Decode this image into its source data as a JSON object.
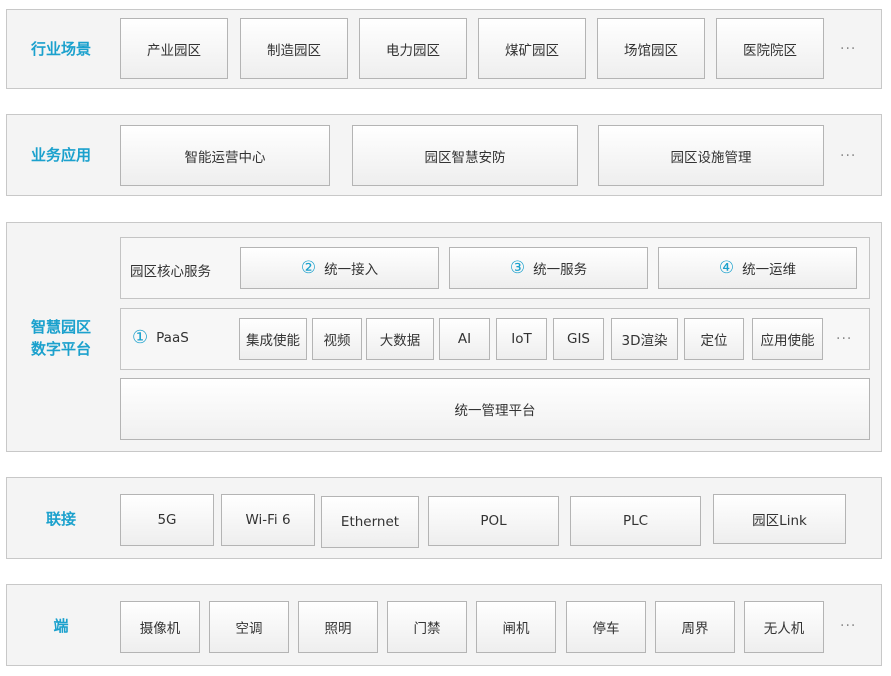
{
  "layers": {
    "scenarios": {
      "label": "行业场景",
      "items": [
        "产业园区",
        "制造园区",
        "电力园区",
        "煤矿园区",
        "场馆园区",
        "医院院区"
      ],
      "more": "···"
    },
    "applications": {
      "label": "业务应用",
      "items": [
        "智能运营中心",
        "园区智慧安防",
        "园区设施管理"
      ],
      "more": "···"
    },
    "platform": {
      "label_line1": "智慧园区",
      "label_line2": "数字平台",
      "core": {
        "label": "园区核心服务",
        "services": [
          {
            "num": "②",
            "name": "统一接入"
          },
          {
            "num": "③",
            "name": "统一服务"
          },
          {
            "num": "④",
            "name": "统一运维"
          }
        ]
      },
      "paas": {
        "num": "①",
        "label": "PaaS",
        "items": [
          "集成使能",
          "视频",
          "大数据",
          "AI",
          "IoT",
          "GIS",
          "3D渲染",
          "定位",
          "应用使能"
        ],
        "more": "···"
      },
      "management": "统一管理平台"
    },
    "connectivity": {
      "label": "联接",
      "items": [
        "5G",
        "Wi-Fi 6",
        "Ethernet",
        "POL",
        "PLC",
        "园区Link"
      ]
    },
    "devices": {
      "label": "端",
      "items": [
        "摄像机",
        "空调",
        "照明",
        "门禁",
        "闸机",
        "停车",
        "周界",
        "无人机"
      ],
      "more": "···"
    }
  },
  "colors": {
    "accent": "#1ba1cd",
    "row_bg": "#f4f4f4",
    "border": "#b4b4b4"
  }
}
